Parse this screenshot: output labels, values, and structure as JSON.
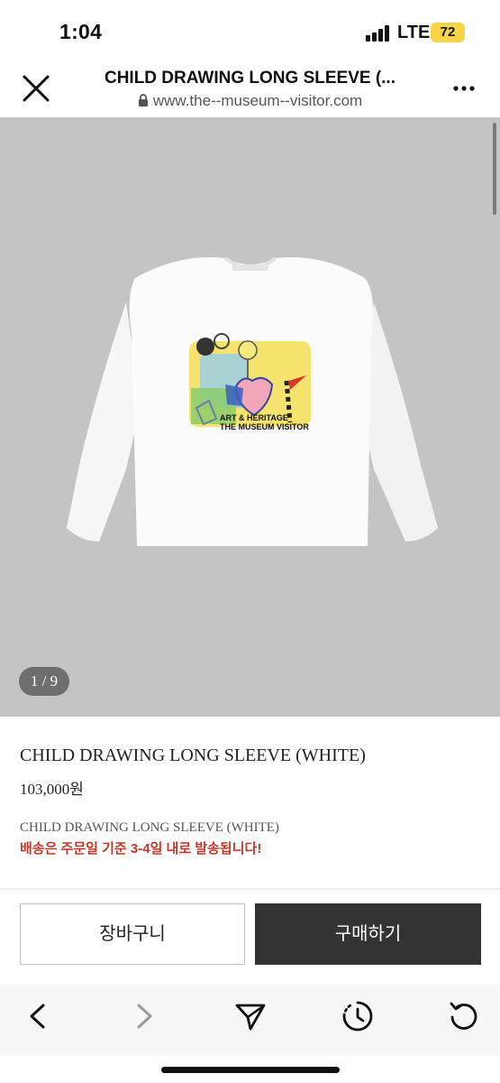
{
  "status_bar": {
    "time": "1:04",
    "network": "LTE",
    "battery": "72",
    "battery_color": "#f7d346"
  },
  "browser": {
    "page_title": "CHILD DRAWING LONG SLEEVE (...",
    "url": "www.the--museum--visitor.com",
    "icons": [
      "close-icon",
      "lock-icon",
      "more-icon"
    ]
  },
  "gallery": {
    "counter": "1 / 9",
    "background": "#c4c4c4",
    "shirt_print_text": [
      "ART & HERITAGE",
      "THE MUSEUM VISITOR"
    ]
  },
  "product": {
    "name": "CHILD DRAWING LONG SLEEVE (WHITE)",
    "price": "103,000원",
    "description": "CHILD DRAWING LONG SLEEVE (WHITE)",
    "shipping_note": "배송은 주문일 기준 3-4일 내로 발송됩니다!",
    "shipping_note_color": "#c0392b"
  },
  "actions": {
    "cart_label": "장바구니",
    "buy_label": "구매하기",
    "buy_color": "#333333"
  },
  "toolbar": {
    "icons": [
      "back-icon",
      "forward-icon",
      "share-icon",
      "history-icon",
      "reload-icon"
    ]
  }
}
